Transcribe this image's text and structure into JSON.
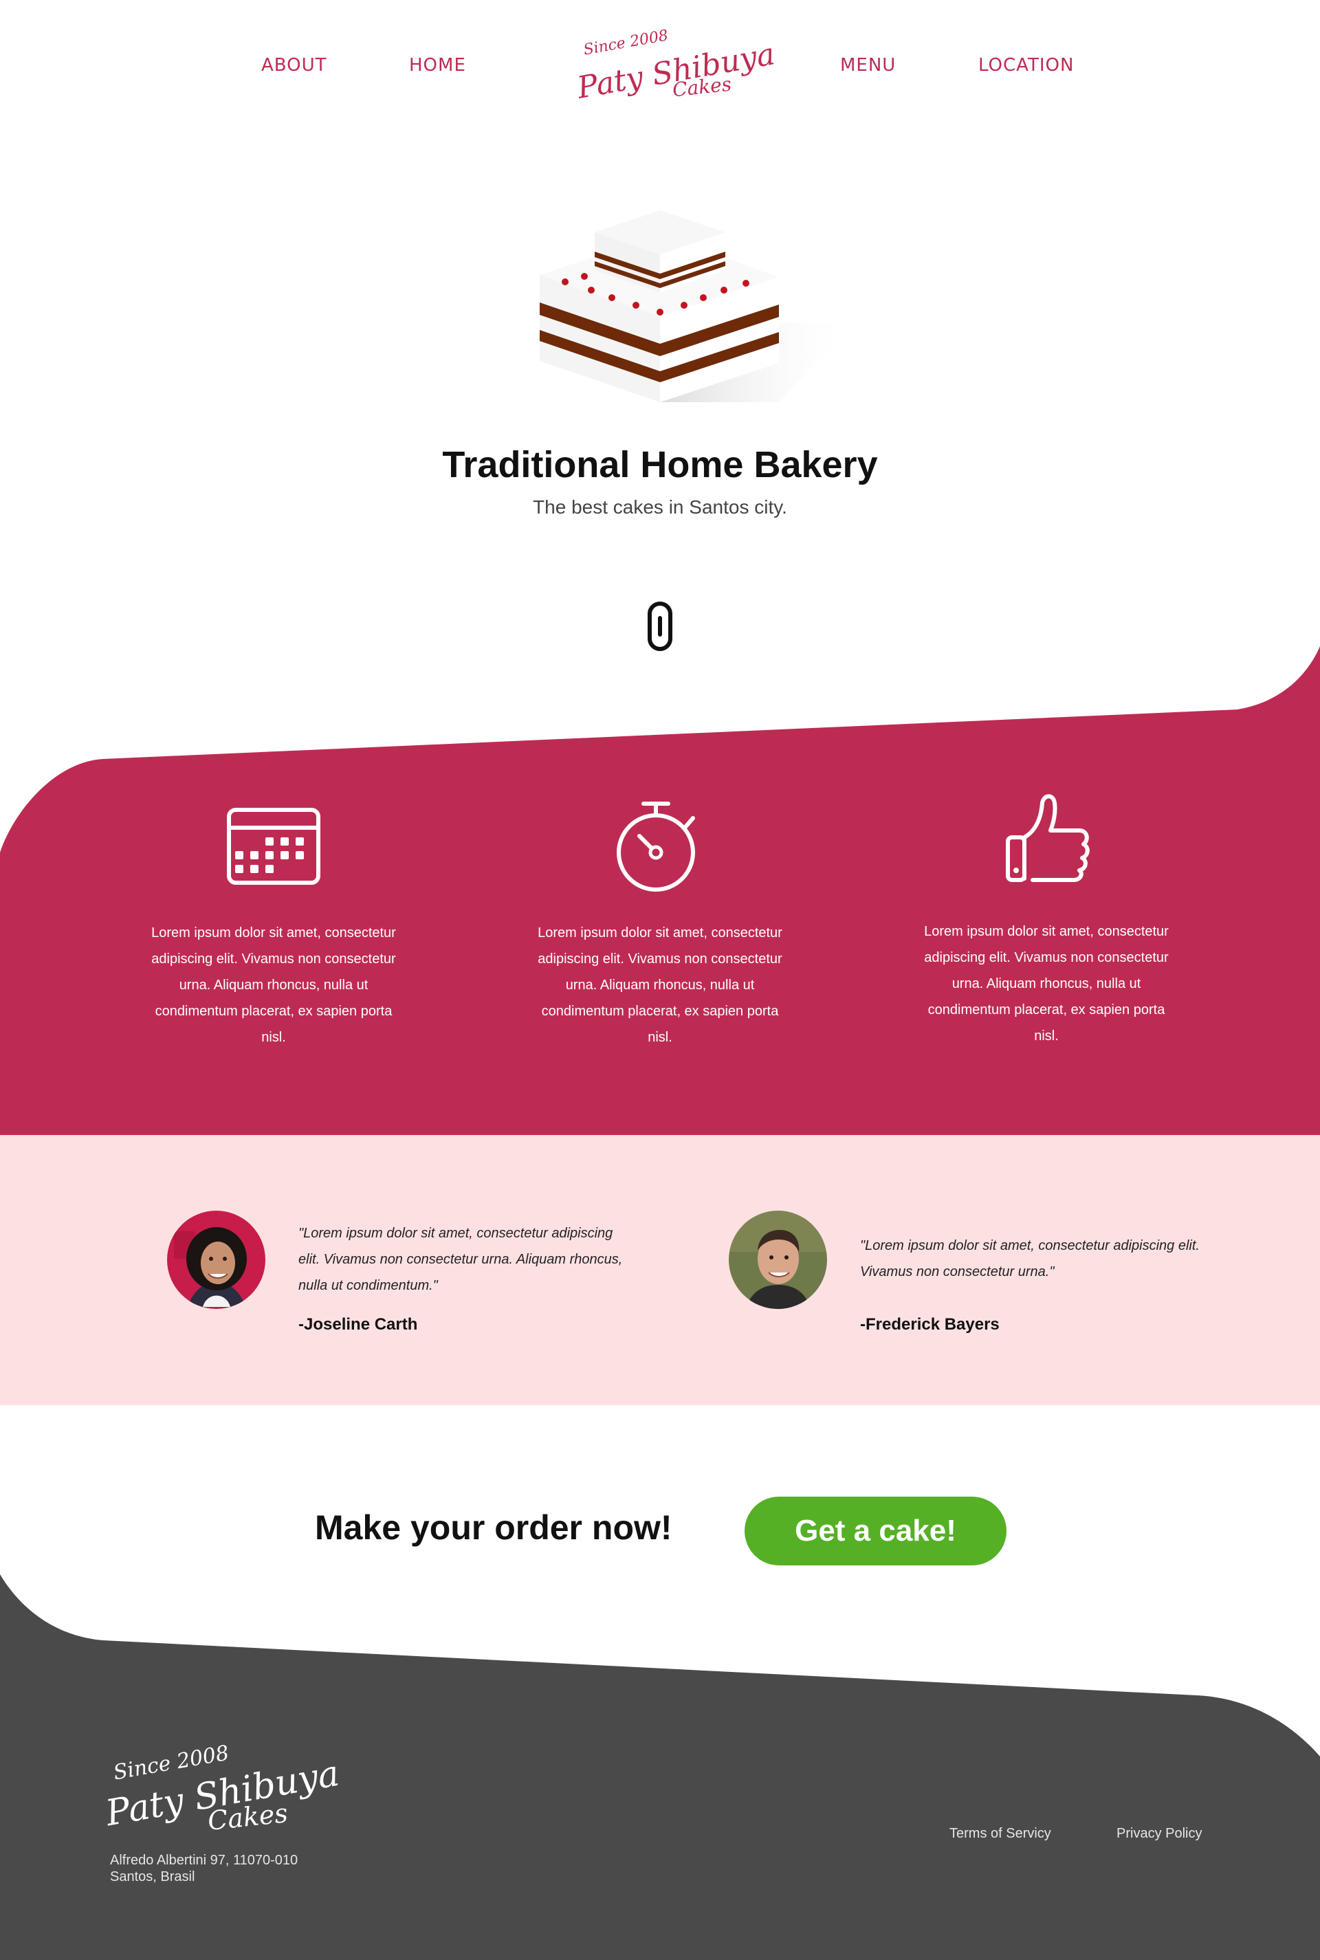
{
  "nav": {
    "about": "ABOUT",
    "home": "HOME",
    "menu": "MENU",
    "location": "LOCATION"
  },
  "logo": {
    "since": "Since 2008",
    "name": "Paty Shibuya",
    "cakes": "Cakes"
  },
  "hero": {
    "title": "Traditional Home Bakery",
    "subtitle": "The best cakes in Santos city.",
    "image": "layer-cake-illustration"
  },
  "features": [
    {
      "icon": "calendar-icon",
      "text": "Lorem ipsum dolor sit amet, consectetur adipiscing elit. Vivamus non consectetur urna. Aliquam rhoncus, nulla ut condimentum placerat, ex sapien porta nisl."
    },
    {
      "icon": "stopwatch-icon",
      "text": "Lorem ipsum dolor sit amet, consectetur adipiscing elit. Vivamus non consectetur urna. Aliquam rhoncus, nulla ut condimentum placerat, ex sapien porta nisl."
    },
    {
      "icon": "thumbs-up-icon",
      "text": "Lorem ipsum dolor sit amet, consectetur adipiscing elit. Vivamus non consectetur urna. Aliquam rhoncus, nulla ut condimentum placerat, ex sapien porta nisl."
    }
  ],
  "testimonials": [
    {
      "quote": "\"Lorem ipsum dolor sit amet, consectetur adipiscing elit. Vivamus non consectetur urna. Aliquam rhoncus, nulla ut condimentum.\"",
      "author": "-Joseline Carth"
    },
    {
      "quote": "\"Lorem ipsum dolor sit amet, consectetur adipiscing elit. Vivamus non consectetur urna.\"",
      "author": "-Frederick Bayers"
    }
  ],
  "cta": {
    "text": "Make your order now!",
    "button": "Get a cake!"
  },
  "footer": {
    "address_line1": "Alfredo Albertini 97, 11070-010",
    "address_line2": "Santos, Brasil",
    "terms": "Terms of Servicy",
    "privacy": "Privacy Policy"
  },
  "colors": {
    "brand": "#be2b52",
    "pink_bg": "#fde1e2",
    "cta_green": "#55b025",
    "footer_bg": "#4a4a4a"
  }
}
